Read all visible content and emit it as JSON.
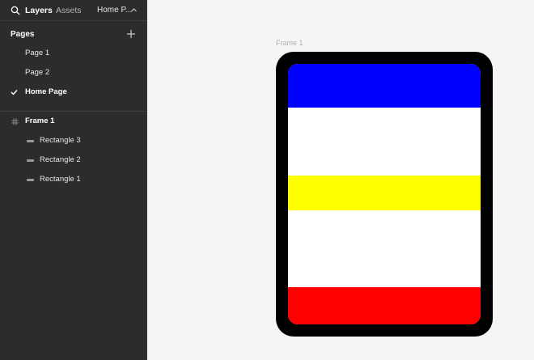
{
  "tabs": {
    "layers": "Layers",
    "assets": "Assets",
    "current_page": "Home P..."
  },
  "pages": {
    "title": "Pages",
    "items": [
      {
        "label": "Page 1",
        "active": false
      },
      {
        "label": "Page 2",
        "active": false
      },
      {
        "label": "Home Page",
        "active": true
      }
    ]
  },
  "layers": {
    "frame": {
      "label": "Frame 1",
      "icon": "frame-icon"
    },
    "children": [
      {
        "label": "Rectangle 3",
        "icon": "rectangle-icon"
      },
      {
        "label": "Rectangle 2",
        "icon": "rectangle-icon"
      },
      {
        "label": "Rectangle 1",
        "icon": "rectangle-icon"
      }
    ]
  },
  "canvas": {
    "frame_label": "Frame 1",
    "colors": {
      "device": "#000000",
      "screen": "#ffffff",
      "top_band": "#0000ff",
      "middle_band": "#ffff00",
      "bottom_band": "#ff0000"
    }
  },
  "theme": {
    "sidebar_bg": "#2c2c2c",
    "canvas_bg": "#f5f5f5"
  }
}
